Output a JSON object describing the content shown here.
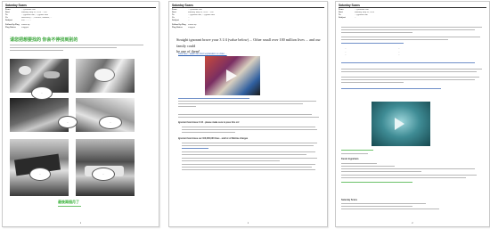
{
  "page1": {
    "sender": "Saturday Scans",
    "headers": [
      {
        "k": "From",
        "v": "...@hotmail.com"
      },
      {
        "k": "Sent",
        "v": "Monday, May 20, 2013 ... PM"
      },
      {
        "k": "To",
        "v": "...@yahoo.com; ...@gmail.com"
      },
      {
        "k": "Cc",
        "v": "Hancock@... ; Ducrest; Gardner; ..."
      },
      {
        "k": "Subject",
        "v": "FW: ... ... ..."
      }
    ],
    "headers2": [
      {
        "k": "Follow Up Flag",
        "v": "Follow up"
      },
      {
        "k": "Flag Status",
        "v": "Flagged"
      }
    ],
    "cjk_title": "请您把想要找的 你会不停找到别的",
    "bubbles": [
      "...",
      "...",
      "...",
      "...",
      "..."
    ],
    "green_caption": "最後兩個月了",
    "page_num": "1"
  },
  "page2": {
    "sender": "Saturday Scans",
    "headers": [
      {
        "k": "From",
        "v": "...@hotmail.com"
      },
      {
        "k": "Sent",
        "v": "Monday, May 20, 2013 ... PM"
      },
      {
        "k": "To",
        "v": "...@yahoo.com; ...@gmail.com"
      },
      {
        "k": "Cc",
        "v": "..."
      },
      {
        "k": "Subject",
        "v": "..."
      }
    ],
    "headers2": [
      {
        "k": "Follow Up Flag",
        "v": "Follow up"
      },
      {
        "k": "Flag Status",
        "v": "Flagged"
      }
    ],
    "lead_1": "Straight ignorant brave your 3 1/4 (value below) ... Other small over 100 million lives ... and our family could",
    "lead_2": "be one of them!",
    "link_caption": "Click here - watch this short explanation on video ...",
    "section_1": "Ignorant how brave 3 1/4 - please make sure to pass this on!",
    "section_2": "Ignorant how brave our 100,000,000 lives - and lot of lifetime charges",
    "page_num": "1"
  },
  "page3": {
    "sender": "Saturday Scans",
    "headers": [
      {
        "k": "From",
        "v": "...@hotmail.com"
      },
      {
        "k": "Sent",
        "v": "Monday, May 20, 2013"
      },
      {
        "k": "To",
        "v": "...@yahoo.com"
      },
      {
        "k": "Subject",
        "v": "..."
      }
    ],
    "table_cells": [
      "...",
      "...",
      "...",
      "...",
      "...",
      "..."
    ],
    "sig_name": "Kevin Ingraham",
    "footer_from": "Saturday Scans",
    "page_num": "2"
  },
  "colors": {
    "cjk_title": "#3aa63a",
    "link": "#2a5db0",
    "green": "#3bb33b"
  }
}
